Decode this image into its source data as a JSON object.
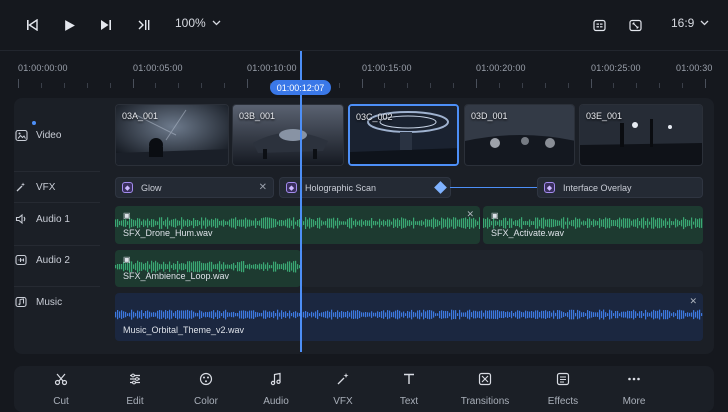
{
  "transport": {
    "zoom_label": "100%",
    "aspect_label": "16:9",
    "icons": [
      "skip-back-icon",
      "play-icon",
      "skip-forward-icon",
      "cut-at-playhead-icon",
      "captions-icon",
      "fit-screen-icon"
    ]
  },
  "ruler": {
    "timecodes": [
      "01:00:00:00",
      "01:00:05:00",
      "01:00:10:00",
      "01:00:15:00",
      "01:00:20:00",
      "01:00:25:00",
      "01:00:30"
    ]
  },
  "playhead": {
    "timecode": "01:00:12:07"
  },
  "tracks": {
    "video": {
      "label": "Video"
    },
    "vfx": {
      "label": "VFX"
    },
    "audio1": {
      "label": "Audio 1"
    },
    "audio2": {
      "label": "Audio 2"
    },
    "music": {
      "label": "Music"
    }
  },
  "video_clips": [
    "03A_001",
    "03B_001",
    "03C_002",
    "03D_001",
    "03E_001"
  ],
  "vfx_clips": [
    "Glow",
    "Holographic Scan",
    "Interface Overlay"
  ],
  "audio_clips": {
    "drone": "SFX_Drone_Hum.wav",
    "activate": "SFX_Activate.wav",
    "ambience": "SFX_Ambience_Loop.wav",
    "music": "Music_Orbital_Theme_v2.wav"
  },
  "toolbar": {
    "items": [
      "Cut",
      "Edit",
      "Color",
      "Audio",
      "VFX",
      "Text",
      "Transitions",
      "Effects",
      "More"
    ]
  },
  "colors": {
    "accent": "#4d8ff7",
    "audio_green": "#2f8a5d",
    "music_blue": "#2a62c9",
    "vfx_purple": "#a48cf0"
  }
}
